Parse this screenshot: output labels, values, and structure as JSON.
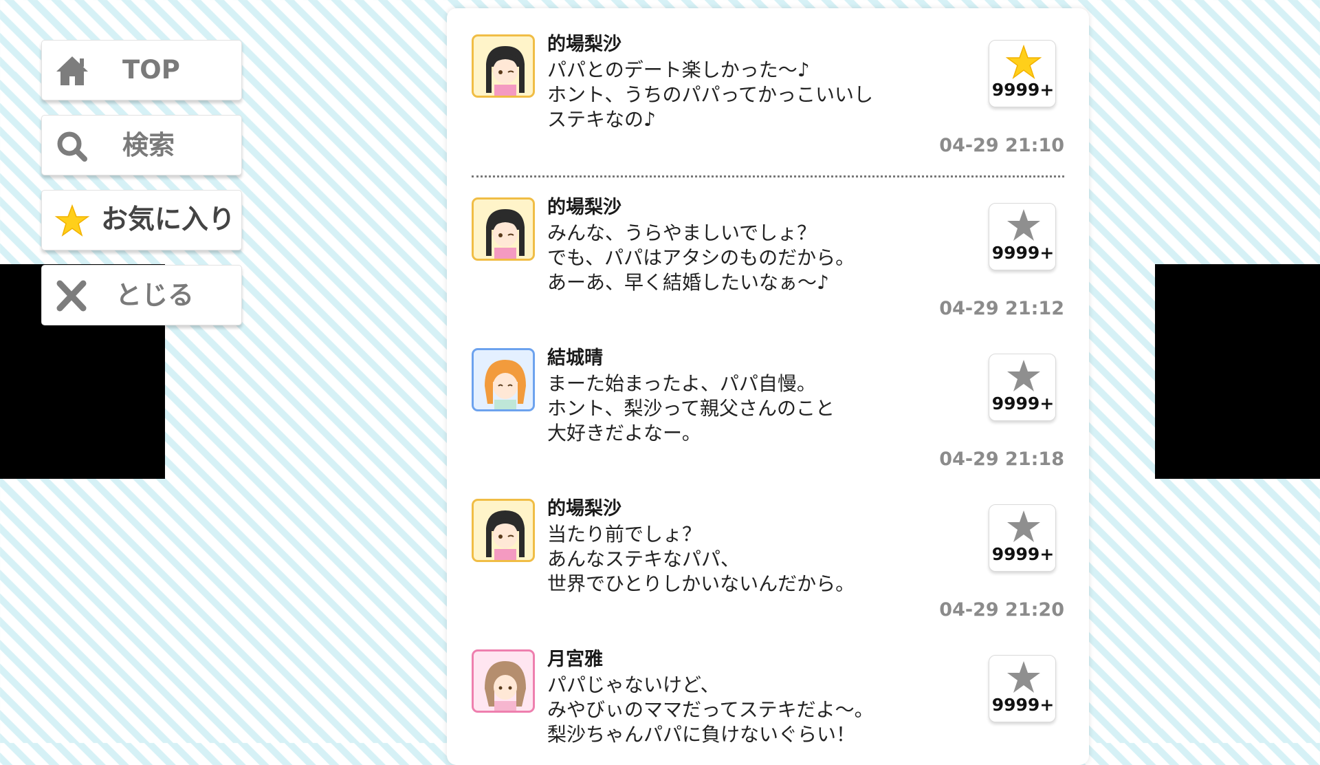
{
  "menu": {
    "top_label": "TOP",
    "search_label": "検索",
    "favorites_label": "お気に入り",
    "close_label": "とじる"
  },
  "colors": {
    "stripe": "#d6f1f6",
    "favorite_star": "#ffcf1a",
    "timestamp": "#8b8b8b"
  },
  "posts": [
    {
      "author": "的場梨沙",
      "lines": [
        "パパとのデート楽しかった～♪",
        "ホント、うちのパパってかっこいいし",
        "ステキなの♪"
      ],
      "time": "04-29 21:10",
      "likes": "9999+",
      "liked": true,
      "avatar_icon": "black-twintail-girl-avatar-icon"
    },
    {
      "author": "的場梨沙",
      "lines": [
        "みんな、うらやましいでしょ？",
        "でも、パパはアタシのものだから。",
        "あーあ、早く結婚したいなぁ～♪"
      ],
      "time": "04-29 21:12",
      "likes": "9999+",
      "liked": false,
      "avatar_icon": "black-twintail-girl-avatar-icon"
    },
    {
      "author": "結城晴",
      "lines": [
        "まーた始まったよ、パパ自慢。",
        "ホント、梨沙って親父さんのこと",
        "大好きだよなー。"
      ],
      "time": "04-29 21:18",
      "likes": "9999+",
      "liked": false,
      "avatar_icon": "orange-hair-girl-avatar-icon"
    },
    {
      "author": "的場梨沙",
      "lines": [
        "当たり前でしょ？",
        "あんなステキなパパ、",
        "世界でひとりしかいないんだから。"
      ],
      "time": "04-29 21:20",
      "likes": "9999+",
      "liked": false,
      "avatar_icon": "black-twintail-girl-avatar-icon"
    },
    {
      "author": "月宮雅",
      "lines": [
        "パパじゃないけど、",
        "みやびぃのママだってステキだよ～。",
        "梨沙ちゃんパパに負けないぐらい！"
      ],
      "time": "",
      "likes": "9999+",
      "liked": false,
      "avatar_icon": "brown-hair-girl-avatar-icon"
    }
  ]
}
